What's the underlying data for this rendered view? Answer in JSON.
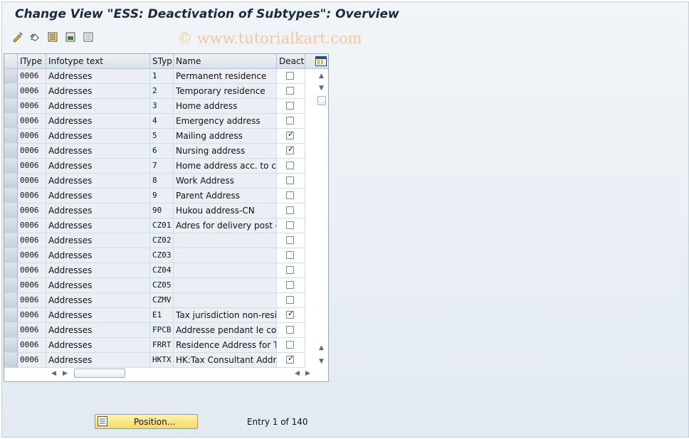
{
  "title": "Change View \"ESS: Deactivation of Subtypes\": Overview",
  "watermark": "© www.tutorialkart.com",
  "toolbar": {
    "icons": [
      "edit-toggle-icon",
      "undo-icon",
      "select-all-icon",
      "select-block-icon",
      "deselect-all-icon"
    ]
  },
  "table": {
    "headers": {
      "itype": "IType",
      "infotype_text": "Infotype text",
      "styp": "STyp",
      "name": "Name",
      "deact": "Deact"
    },
    "rows": [
      {
        "itype": "0006",
        "infotype_text": "Addresses",
        "styp": "1",
        "name": "Permanent residence",
        "deact": false
      },
      {
        "itype": "0006",
        "infotype_text": "Addresses",
        "styp": "2",
        "name": "Temporary residence",
        "deact": false
      },
      {
        "itype": "0006",
        "infotype_text": "Addresses",
        "styp": "3",
        "name": "Home address",
        "deact": false
      },
      {
        "itype": "0006",
        "infotype_text": "Addresses",
        "styp": "4",
        "name": "Emergency address",
        "deact": false
      },
      {
        "itype": "0006",
        "infotype_text": "Addresses",
        "styp": "5",
        "name": "Mailing address",
        "deact": true
      },
      {
        "itype": "0006",
        "infotype_text": "Addresses",
        "styp": "6",
        "name": "Nursing address",
        "deact": true
      },
      {
        "itype": "0006",
        "infotype_text": "Addresses",
        "styp": "7",
        "name": "Home address acc. to co...",
        "deact": false
      },
      {
        "itype": "0006",
        "infotype_text": "Addresses",
        "styp": "8",
        "name": "Work Address",
        "deact": false
      },
      {
        "itype": "0006",
        "infotype_text": "Addresses",
        "styp": "9",
        "name": "Parent Address",
        "deact": false
      },
      {
        "itype": "0006",
        "infotype_text": "Addresses",
        "styp": "90",
        "name": "Hukou address-CN",
        "deact": false
      },
      {
        "itype": "0006",
        "infotype_text": "Addresses",
        "styp": "CZ01",
        "name": "Adres for delivery post c...",
        "deact": false
      },
      {
        "itype": "0006",
        "infotype_text": "Addresses",
        "styp": "CZ02",
        "name": "",
        "deact": false
      },
      {
        "itype": "0006",
        "infotype_text": "Addresses",
        "styp": "CZ03",
        "name": "",
        "deact": false
      },
      {
        "itype": "0006",
        "infotype_text": "Addresses",
        "styp": "CZ04",
        "name": "",
        "deact": false
      },
      {
        "itype": "0006",
        "infotype_text": "Addresses",
        "styp": "CZ05",
        "name": "",
        "deact": false
      },
      {
        "itype": "0006",
        "infotype_text": "Addresses",
        "styp": "CZMV",
        "name": "",
        "deact": false
      },
      {
        "itype": "0006",
        "infotype_text": "Addresses",
        "styp": "E1",
        "name": "Tax jurisdiction non-resid...",
        "deact": true
      },
      {
        "itype": "0006",
        "infotype_text": "Addresses",
        "styp": "FPCB",
        "name": "Addresse pendant le con...",
        "deact": false
      },
      {
        "itype": "0006",
        "infotype_text": "Addresses",
        "styp": "FRRT",
        "name": "Residence Address for Ti...",
        "deact": false
      },
      {
        "itype": "0006",
        "infotype_text": "Addresses",
        "styp": "HKTX",
        "name": "HK:Tax Consultant Addre...",
        "deact": true
      }
    ]
  },
  "position_button": {
    "label": "Position..."
  },
  "entry_info": "Entry 1 of 140",
  "colors": {
    "accent": "#f6d95c",
    "header": "#d9e1ea",
    "readonly": "#e9eff5"
  }
}
